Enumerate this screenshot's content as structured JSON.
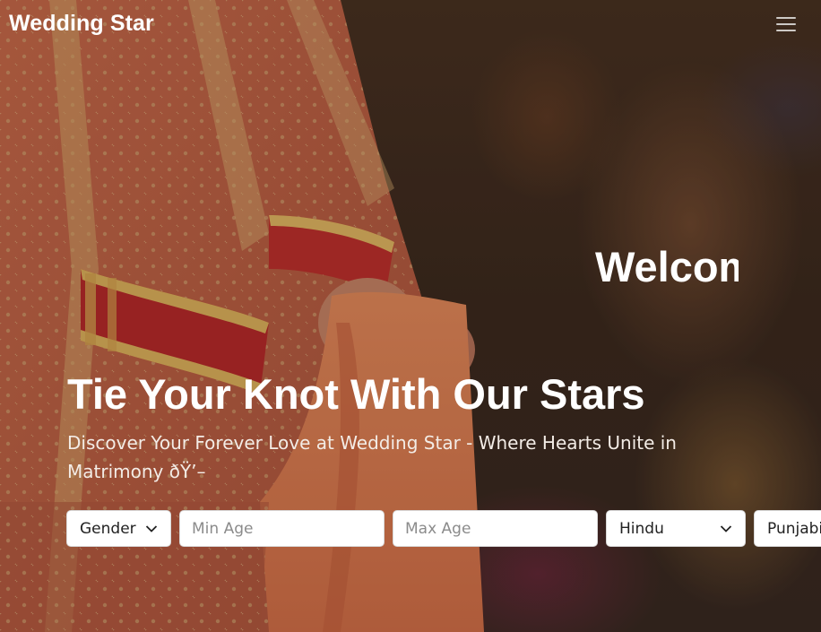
{
  "navbar": {
    "brand": "Wedding Star",
    "menu_icon": "hamburger-menu-icon"
  },
  "hero": {
    "welcome_text": "Welcome",
    "headline": "Tie Your Knot With Our Stars",
    "subheadline": "Discover Your Forever Love at Wedding Star - Where Hearts Unite in Matrimony ðŸ’–"
  },
  "search": {
    "gender": {
      "selected": "Gender",
      "icon": "chevron-down-icon"
    },
    "min_age": {
      "placeholder": "Min Age",
      "value": ""
    },
    "max_age": {
      "placeholder": "Max Age",
      "value": ""
    },
    "religion": {
      "selected": "Hindu",
      "icon": "chevron-down-icon"
    },
    "community": {
      "selected": "Punjabi"
    }
  },
  "colors": {
    "brand_text": "#ffffff",
    "field_bg": "#ffffff",
    "placeholder": "#8b8b8b"
  }
}
